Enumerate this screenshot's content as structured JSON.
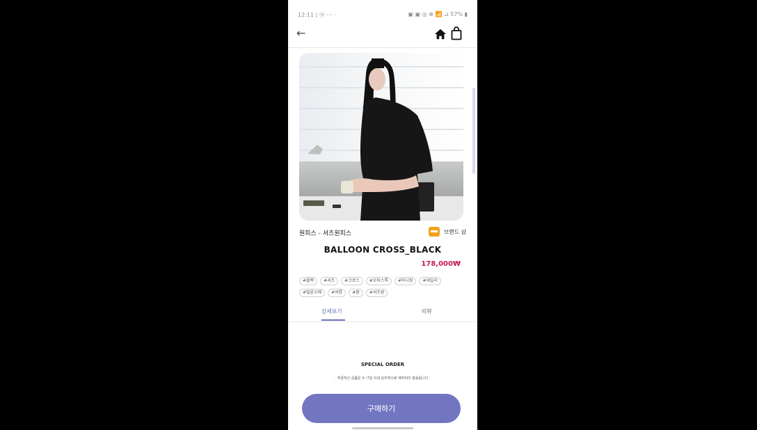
{
  "status_bar": {
    "left_text": "12:11 | ⓦ ⋯ ·",
    "right_text": "▣ ▣ ◎ ⊕ 📶 ⊿ 57% ▮"
  },
  "app_bar": {
    "back_icon": "back-arrow-icon",
    "home_icon": "home-icon",
    "bag_icon": "shopping-bag-icon"
  },
  "product": {
    "category": "원피스 - 셔츠원피스",
    "brand": "브랜드 샵",
    "title": "BALLOON CROSS_BLACK",
    "price": "178,000₩",
    "tags": [
      [
        "#블랙",
        "#셔츠",
        "#크로스",
        "#오피스룩",
        "#미니원",
        "#데일리"
      ],
      [
        "#벌룬소매",
        "#여름",
        "#봄",
        "#셔츠원"
      ]
    ]
  },
  "tabs": {
    "detail": "상세보기",
    "review": "리뷰"
  },
  "footer_info": {
    "special": "SPECIAL ORDER",
    "note": "· 주문하신 상품은 3~7일 이내 순차적으로 제작되어 발송됩니다 ·"
  },
  "buy_button": "구매하기",
  "colors": {
    "accent": "#7276c1",
    "price": "#c4195b",
    "tab_active": "#6770b7"
  }
}
